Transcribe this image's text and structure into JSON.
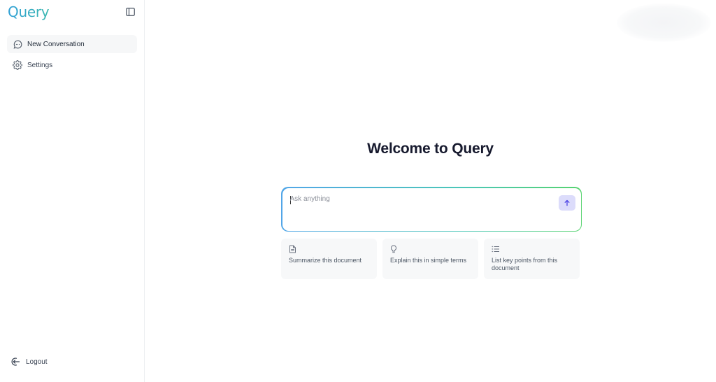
{
  "app": {
    "name": "Query"
  },
  "sidebar": {
    "items": [
      {
        "label": "New Conversation",
        "icon": "chat-bubble-icon",
        "active": true
      },
      {
        "label": "Settings",
        "icon": "gear-icon",
        "active": false
      }
    ],
    "logout_label": "Logout"
  },
  "main": {
    "welcome": "Welcome to Query",
    "input": {
      "placeholder": "Ask anything",
      "value": ""
    },
    "suggestions": [
      {
        "label": "Summarize this document",
        "icon": "document-icon"
      },
      {
        "label": "Explain this in simple terms",
        "icon": "lightbulb-icon"
      },
      {
        "label": "List key points from this document",
        "icon": "list-icon"
      }
    ]
  },
  "colors": {
    "accent": "#2f9fd6",
    "input_border_start": "#52a6e8",
    "input_border_end": "#57d36f",
    "send_button_bg": "#dcdcfb",
    "send_arrow": "#4f46e5",
    "heading": "#171a2e"
  }
}
